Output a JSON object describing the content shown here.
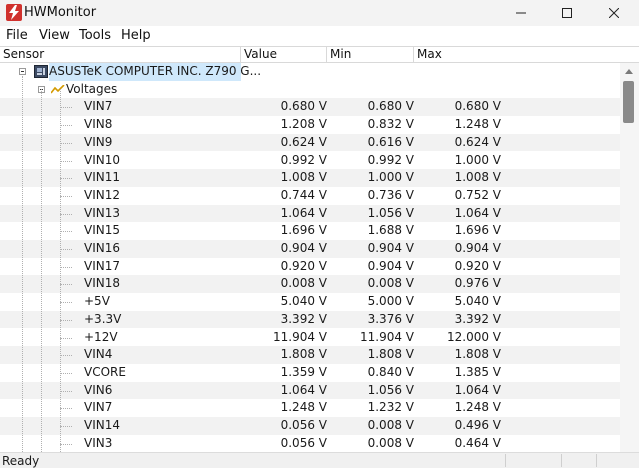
{
  "window": {
    "title": "HWMonitor"
  },
  "menu": [
    "File",
    "View",
    "Tools",
    "Help"
  ],
  "columns": [
    "Sensor",
    "Value",
    "Min",
    "Max"
  ],
  "device": {
    "name": "ASUSTeK COMPUTER INC. Z790 G..."
  },
  "group": {
    "name": "Voltages"
  },
  "sensors": [
    {
      "name": "VIN7",
      "value": "0.680 V",
      "min": "0.680 V",
      "max": "0.680 V"
    },
    {
      "name": "VIN8",
      "value": "1.208 V",
      "min": "0.832 V",
      "max": "1.248 V"
    },
    {
      "name": "VIN9",
      "value": "0.624 V",
      "min": "0.616 V",
      "max": "0.624 V"
    },
    {
      "name": "VIN10",
      "value": "0.992 V",
      "min": "0.992 V",
      "max": "1.000 V"
    },
    {
      "name": "VIN11",
      "value": "1.008 V",
      "min": "1.000 V",
      "max": "1.008 V"
    },
    {
      "name": "VIN12",
      "value": "0.744 V",
      "min": "0.736 V",
      "max": "0.752 V"
    },
    {
      "name": "VIN13",
      "value": "1.064 V",
      "min": "1.056 V",
      "max": "1.064 V"
    },
    {
      "name": "VIN15",
      "value": "1.696 V",
      "min": "1.688 V",
      "max": "1.696 V"
    },
    {
      "name": "VIN16",
      "value": "0.904 V",
      "min": "0.904 V",
      "max": "0.904 V"
    },
    {
      "name": "VIN17",
      "value": "0.920 V",
      "min": "0.904 V",
      "max": "0.920 V"
    },
    {
      "name": "VIN18",
      "value": "0.008 V",
      "min": "0.008 V",
      "max": "0.976 V"
    },
    {
      "name": "+5V",
      "value": "5.040 V",
      "min": "5.000 V",
      "max": "5.040 V"
    },
    {
      "name": "+3.3V",
      "value": "3.392 V",
      "min": "3.376 V",
      "max": "3.392 V"
    },
    {
      "name": "+12V",
      "value": "11.904 V",
      "min": "11.904 V",
      "max": "12.000 V"
    },
    {
      "name": "VIN4",
      "value": "1.808 V",
      "min": "1.808 V",
      "max": "1.808 V"
    },
    {
      "name": "VCORE",
      "value": "1.359 V",
      "min": "0.840 V",
      "max": "1.385 V"
    },
    {
      "name": "VIN6",
      "value": "1.064 V",
      "min": "1.056 V",
      "max": "1.064 V"
    },
    {
      "name": "VIN7",
      "value": "1.248 V",
      "min": "1.232 V",
      "max": "1.248 V"
    },
    {
      "name": "VIN14",
      "value": "0.056 V",
      "min": "0.008 V",
      "max": "0.496 V"
    },
    {
      "name": "VIN3",
      "value": "0.056 V",
      "min": "0.008 V",
      "max": "0.464 V"
    }
  ],
  "status": {
    "text": "Ready"
  }
}
